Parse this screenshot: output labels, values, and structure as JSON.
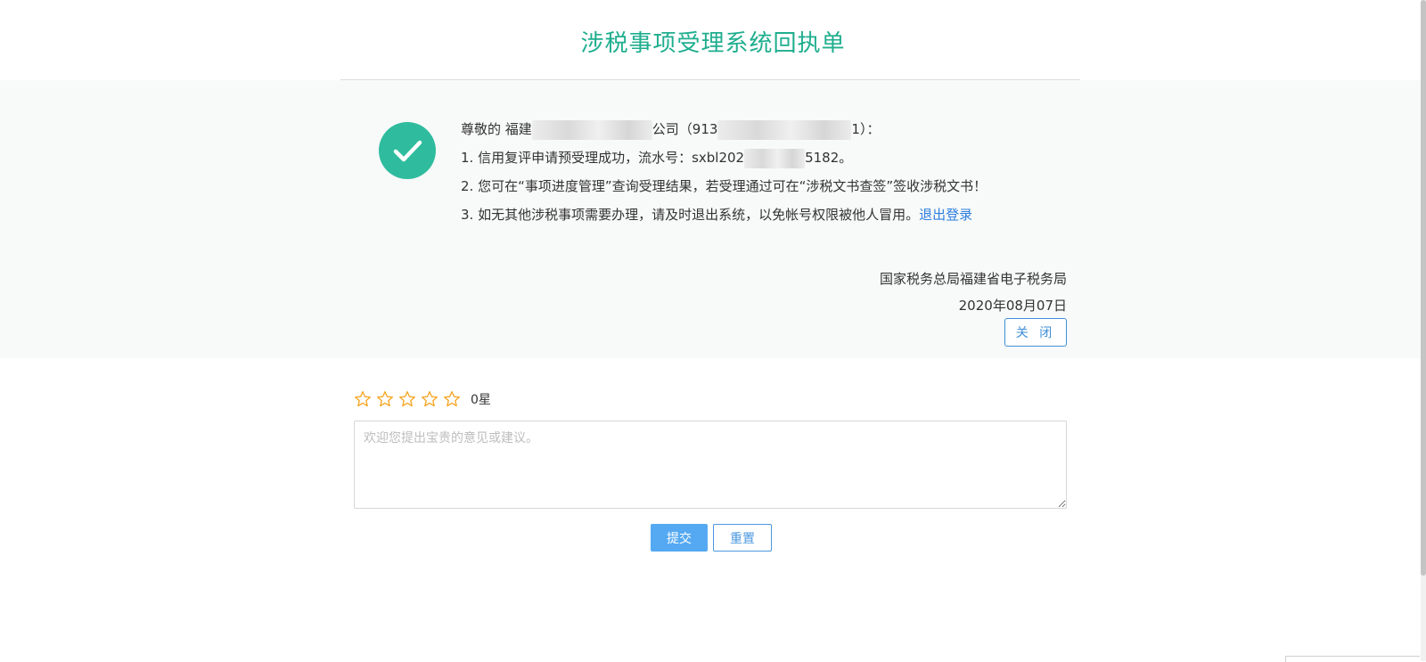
{
  "page": {
    "title": "涉税事项受理系统回执单"
  },
  "receipt": {
    "greeting_prefix": "尊敬的 福建",
    "company_suffix": "公司（913",
    "greeting_end": "1）：",
    "line1_prefix": "1. 信用复评申请预受理成功，流水号：sxbl202",
    "line1_suffix": "5182。",
    "line2": "2. 您可在“事项进度管理”查询受理结果，若受理通过可在“涉税文书查签”签收涉税文书！",
    "line3_prefix": "3. 如无其他涉税事项需要办理，请及时退出系统，以免帐号权限被他人冒用。",
    "logout_link": "退出登录",
    "issuer": "国家税务总局福建省电子税务局",
    "date": "2020年08月07日",
    "close_button": "关 闭"
  },
  "rating": {
    "stars_total": 5,
    "stars_selected": 0,
    "count_label": "0星",
    "star_color": "#f5a623"
  },
  "feedback": {
    "placeholder": "欢迎您提出宝贵的意见或建议。",
    "value": "",
    "submit_button": "提交",
    "reset_button": "重置"
  },
  "colors": {
    "title": "#1fae8e",
    "check": "#2fbc9e",
    "link": "#2d7fe0",
    "primary_button": "#55a9f2"
  },
  "icons": {
    "success": "checkmark-circle-icon",
    "star": "star-outline-icon"
  }
}
